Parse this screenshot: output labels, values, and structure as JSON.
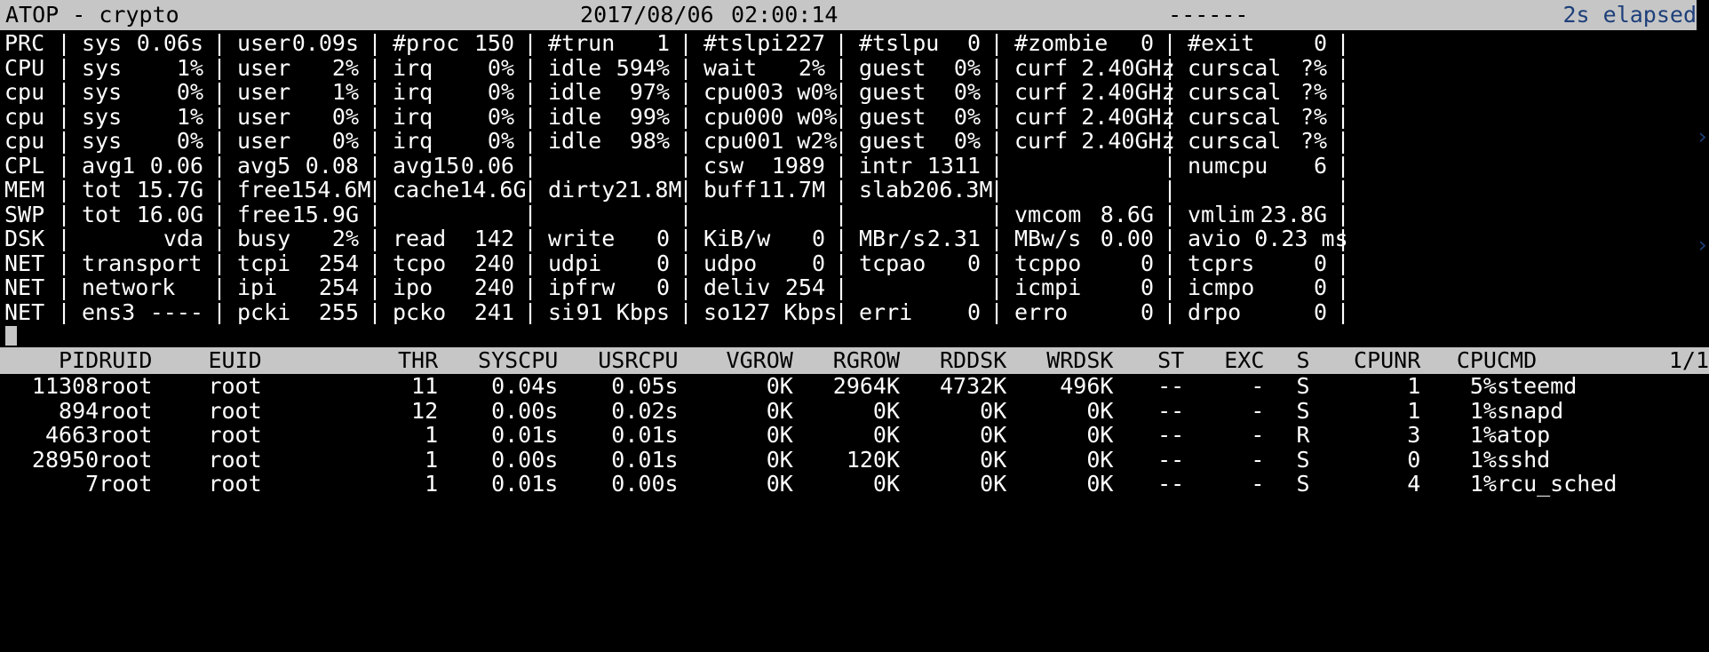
{
  "titlebar": {
    "app": "ATOP - crypto",
    "date": "2017/08/06",
    "time": "02:00:14",
    "dashes": "------",
    "elapsed": "2s elapsed"
  },
  "sys_rows": [
    {
      "label": "PRC",
      "cells": [
        {
          "name": "sys",
          "value": "0.06s"
        },
        {
          "name": "user",
          "value": "0.09s"
        },
        {
          "name": "#proc",
          "value": "150"
        },
        {
          "name": "#trun",
          "value": "1"
        },
        {
          "name": "#tslpi",
          "value": "227"
        },
        {
          "name": "#tslpu",
          "value": "0"
        },
        {
          "name": "#zombie",
          "value": "0"
        },
        {
          "name": "#exit",
          "value": "0"
        }
      ]
    },
    {
      "label": "CPU",
      "cells": [
        {
          "name": "sys",
          "value": "1%"
        },
        {
          "name": "user",
          "value": "2%"
        },
        {
          "name": "irq",
          "value": "0%"
        },
        {
          "name": "idle",
          "value": "594%"
        },
        {
          "name": "wait",
          "value": "2%"
        },
        {
          "name": "guest",
          "value": "0%"
        },
        {
          "name": "curf 2.40GHz",
          "value": ""
        },
        {
          "name": "curscal",
          "value": "?%"
        }
      ]
    },
    {
      "label": "cpu",
      "cells": [
        {
          "name": "sys",
          "value": "0%"
        },
        {
          "name": "user",
          "value": "1%"
        },
        {
          "name": "irq",
          "value": "0%"
        },
        {
          "name": "idle",
          "value": "97%"
        },
        {
          "name": "cpu003 w",
          "value": "0%"
        },
        {
          "name": "guest",
          "value": "0%"
        },
        {
          "name": "curf 2.40GHz",
          "value": ""
        },
        {
          "name": "curscal",
          "value": "?%"
        }
      ]
    },
    {
      "label": "cpu",
      "cells": [
        {
          "name": "sys",
          "value": "1%"
        },
        {
          "name": "user",
          "value": "0%"
        },
        {
          "name": "irq",
          "value": "0%"
        },
        {
          "name": "idle",
          "value": "99%"
        },
        {
          "name": "cpu000 w",
          "value": "0%"
        },
        {
          "name": "guest",
          "value": "0%"
        },
        {
          "name": "curf 2.40GHz",
          "value": ""
        },
        {
          "name": "curscal",
          "value": "?%"
        }
      ]
    },
    {
      "label": "cpu",
      "cells": [
        {
          "name": "sys",
          "value": "0%"
        },
        {
          "name": "user",
          "value": "0%"
        },
        {
          "name": "irq",
          "value": "0%"
        },
        {
          "name": "idle",
          "value": "98%"
        },
        {
          "name": "cpu001 w",
          "value": "2%"
        },
        {
          "name": "guest",
          "value": "0%"
        },
        {
          "name": "curf 2.40GHz",
          "value": ""
        },
        {
          "name": "curscal",
          "value": "?%"
        }
      ]
    },
    {
      "label": "CPL",
      "cells": [
        {
          "name": "avg1",
          "value": "0.06"
        },
        {
          "name": "avg5",
          "value": "0.08"
        },
        {
          "name": "avg15",
          "value": "0.06"
        },
        {
          "name": "",
          "value": ""
        },
        {
          "name": "csw",
          "value": "1989"
        },
        {
          "name": "intr",
          "value": "1311"
        },
        {
          "name": "",
          "value": ""
        },
        {
          "name": "numcpu",
          "value": "6"
        }
      ]
    },
    {
      "label": "MEM",
      "cells": [
        {
          "name": "tot",
          "value": "15.7G"
        },
        {
          "name": "free",
          "value": "154.6M"
        },
        {
          "name": "cache",
          "value": "14.6G"
        },
        {
          "name": "dirty",
          "value": "21.8M"
        },
        {
          "name": "buff",
          "value": "11.7M"
        },
        {
          "name": "slab",
          "value": "206.3M"
        },
        {
          "name": "",
          "value": ""
        },
        {
          "name": "",
          "value": ""
        }
      ]
    },
    {
      "label": "SWP",
      "cells": [
        {
          "name": "tot",
          "value": "16.0G"
        },
        {
          "name": "free",
          "value": "15.9G"
        },
        {
          "name": "",
          "value": ""
        },
        {
          "name": "",
          "value": ""
        },
        {
          "name": "",
          "value": ""
        },
        {
          "name": "",
          "value": ""
        },
        {
          "name": "vmcom",
          "value": "8.6G"
        },
        {
          "name": "vmlim",
          "value": "23.8G"
        }
      ]
    },
    {
      "label": "DSK",
      "cells": [
        {
          "name": "",
          "value": "vda",
          "center": true
        },
        {
          "name": "busy",
          "value": "2%"
        },
        {
          "name": "read",
          "value": "142"
        },
        {
          "name": "write",
          "value": "0"
        },
        {
          "name": "KiB/w",
          "value": "0"
        },
        {
          "name": "MBr/s",
          "value": "2.31"
        },
        {
          "name": "MBw/s",
          "value": "0.00"
        },
        {
          "name": "avio 0.23 ms",
          "value": ""
        }
      ]
    },
    {
      "label": "NET",
      "cells": [
        {
          "name": "transport",
          "value": "",
          "leftonly": true
        },
        {
          "name": "tcpi",
          "value": "254"
        },
        {
          "name": "tcpo",
          "value": "240"
        },
        {
          "name": "udpi",
          "value": "0"
        },
        {
          "name": "udpo",
          "value": "0"
        },
        {
          "name": "tcpao",
          "value": "0"
        },
        {
          "name": "tcppo",
          "value": "0"
        },
        {
          "name": "tcprs",
          "value": "0"
        }
      ]
    },
    {
      "label": "NET",
      "cells": [
        {
          "name": "network",
          "value": "",
          "leftonly": true
        },
        {
          "name": "ipi",
          "value": "254"
        },
        {
          "name": "ipo",
          "value": "240"
        },
        {
          "name": "ipfrw",
          "value": "0"
        },
        {
          "name": "deliv",
          "value": "254"
        },
        {
          "name": "",
          "value": ""
        },
        {
          "name": "icmpi",
          "value": "0"
        },
        {
          "name": "icmpo",
          "value": "0"
        }
      ]
    },
    {
      "label": "NET",
      "cells": [
        {
          "name": "ens3",
          "value": "----"
        },
        {
          "name": "pcki",
          "value": "255"
        },
        {
          "name": "pcko",
          "value": "241"
        },
        {
          "name": "si",
          "value": "91 Kbps"
        },
        {
          "name": "so",
          "value": "127 Kbps"
        },
        {
          "name": "erri",
          "value": "0"
        },
        {
          "name": "erro",
          "value": "0"
        },
        {
          "name": "drpo",
          "value": "0"
        }
      ]
    }
  ],
  "proc_table": {
    "columns": [
      "PID",
      "RUID",
      "EUID",
      "THR",
      "SYSCPU",
      "USRCPU",
      "VGROW",
      "RGROW",
      "RDDSK",
      "WRDSK",
      "ST",
      "EXC",
      "S",
      "CPUNR",
      "CPU",
      "CMD"
    ],
    "pager": "1/1",
    "rows": [
      {
        "pid": "11308",
        "ruid": "root",
        "euid": "root",
        "thr": "11",
        "syscpu": "0.04s",
        "usrcpu": "0.05s",
        "vgrow": "0K",
        "rgrow": "2964K",
        "rddsk": "4732K",
        "wrdsk": "496K",
        "st": "--",
        "exc": "-",
        "s": "S",
        "cpunr": "1",
        "cpu": "5%",
        "cmd": "steemd"
      },
      {
        "pid": "894",
        "ruid": "root",
        "euid": "root",
        "thr": "12",
        "syscpu": "0.00s",
        "usrcpu": "0.02s",
        "vgrow": "0K",
        "rgrow": "0K",
        "rddsk": "0K",
        "wrdsk": "0K",
        "st": "--",
        "exc": "-",
        "s": "S",
        "cpunr": "1",
        "cpu": "1%",
        "cmd": "snapd"
      },
      {
        "pid": "4663",
        "ruid": "root",
        "euid": "root",
        "thr": "1",
        "syscpu": "0.01s",
        "usrcpu": "0.01s",
        "vgrow": "0K",
        "rgrow": "0K",
        "rddsk": "0K",
        "wrdsk": "0K",
        "st": "--",
        "exc": "-",
        "s": "R",
        "cpunr": "3",
        "cpu": "1%",
        "cmd": "atop"
      },
      {
        "pid": "28950",
        "ruid": "root",
        "euid": "root",
        "thr": "1",
        "syscpu": "0.00s",
        "usrcpu": "0.01s",
        "vgrow": "0K",
        "rgrow": "120K",
        "rddsk": "0K",
        "wrdsk": "0K",
        "st": "--",
        "exc": "-",
        "s": "S",
        "cpunr": "0",
        "cpu": "1%",
        "cmd": "sshd"
      },
      {
        "pid": "7",
        "ruid": "root",
        "euid": "root",
        "thr": "1",
        "syscpu": "0.01s",
        "usrcpu": "0.00s",
        "vgrow": "0K",
        "rgrow": "0K",
        "rddsk": "0K",
        "wrdsk": "0K",
        "st": "--",
        "exc": "-",
        "s": "S",
        "cpunr": "4",
        "cpu": "1%",
        "cmd": "rcu_sched"
      }
    ]
  },
  "colors": {
    "background": "#000000",
    "foreground": "#ffffff",
    "header_bg": "#c6c6c6",
    "header_fg": "#000000",
    "accent_blue": "#1d3f7a"
  }
}
